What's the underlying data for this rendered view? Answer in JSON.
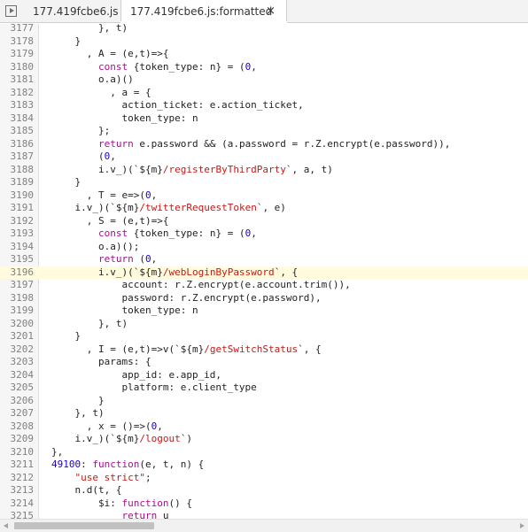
{
  "tabs": [
    {
      "label": "177.419fcbe6.js",
      "active": false
    },
    {
      "label": "177.419fcbe6.js:formatted",
      "active": true
    }
  ],
  "close_symbol": "×",
  "icons": {
    "navigator_toggle": "panel-toggle-icon",
    "close": "close-icon"
  },
  "colors": {
    "keyword": "#aa0d91",
    "string": "#c41a16",
    "number": "#1c00cf",
    "highlight_line": "#fffbdc",
    "gutter_text": "#808080"
  },
  "highlighted_line": 3196,
  "lines": [
    {
      "n": "3177",
      "t": "            }, t)"
    },
    {
      "n": "3178",
      "t": "        }"
    },
    {
      "n": "3179",
      "t": "          , A = (e,t)=>{"
    },
    {
      "n": "3180",
      "t": "            const {token_type: n} = (0,"
    },
    {
      "n": "3181",
      "t": "            o.a)()"
    },
    {
      "n": "3182",
      "t": "              , a = {"
    },
    {
      "n": "3183",
      "t": "                action_ticket: e.action_ticket,"
    },
    {
      "n": "3184",
      "t": "                token_type: n"
    },
    {
      "n": "3185",
      "t": "            };"
    },
    {
      "n": "3186",
      "t": "            return e.password && (a.password = r.Z.encrypt(e.password)),"
    },
    {
      "n": "3187",
      "t": "            (0,"
    },
    {
      "n": "3188",
      "t": "            i.v_)(`${m}/registerByThirdParty`, a, t)"
    },
    {
      "n": "3189",
      "t": "        }"
    },
    {
      "n": "3190",
      "t": "          , T = e=>(0,"
    },
    {
      "n": "3191",
      "t": "        i.v_)(`${m}/twitterRequestToken`, e)"
    },
    {
      "n": "3192",
      "t": "          , S = (e,t)=>{"
    },
    {
      "n": "3193",
      "t": "            const {token_type: n} = (0,"
    },
    {
      "n": "3194",
      "t": "            o.a)();"
    },
    {
      "n": "3195",
      "t": "            return (0,"
    },
    {
      "n": "3196",
      "t": "            i.v_)(`${m}/webLoginByPassword`, {"
    },
    {
      "n": "3197",
      "t": "                account: r.Z.encrypt(e.account.trim()),"
    },
    {
      "n": "3198",
      "t": "                password: r.Z.encrypt(e.password),"
    },
    {
      "n": "3199",
      "t": "                token_type: n"
    },
    {
      "n": "3200",
      "t": "            }, t)"
    },
    {
      "n": "3201",
      "t": "        }"
    },
    {
      "n": "3202",
      "t": "          , I = (e,t)=>v(`${m}/getSwitchStatus`, {"
    },
    {
      "n": "3203",
      "t": "            params: {"
    },
    {
      "n": "3204",
      "t": "                app_id: e.app_id,"
    },
    {
      "n": "3205",
      "t": "                platform: e.client_type"
    },
    {
      "n": "3206",
      "t": "            }"
    },
    {
      "n": "3207",
      "t": "        }, t)"
    },
    {
      "n": "3208",
      "t": "          , x = ()=>(0,"
    },
    {
      "n": "3209",
      "t": "        i.v_)(`${m}/logout`)"
    },
    {
      "n": "3210",
      "t": "    },"
    },
    {
      "n": "3211",
      "t": "    49100: function(e, t, n) {"
    },
    {
      "n": "3212",
      "t": "        \"use strict\";"
    },
    {
      "n": "3213",
      "t": "        n.d(t, {"
    },
    {
      "n": "3214",
      "t": "            $i: function() {"
    },
    {
      "n": "3215",
      "t": "                return u"
    }
  ]
}
